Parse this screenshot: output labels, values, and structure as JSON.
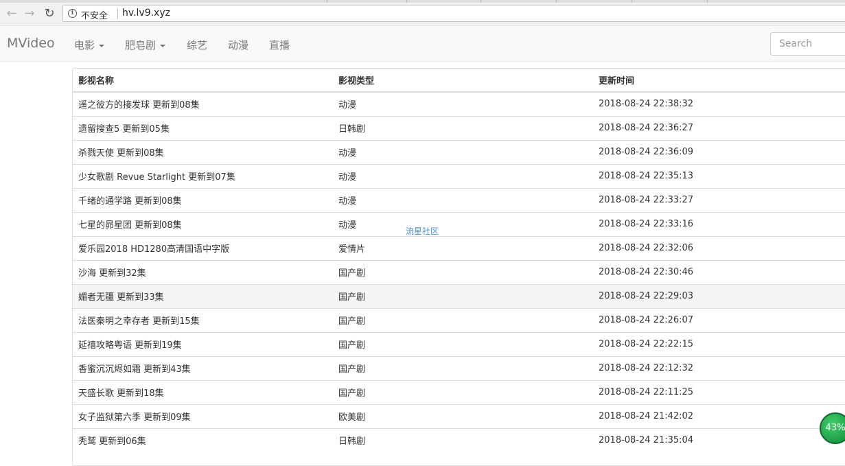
{
  "browser": {
    "security_label": "不安全",
    "url": "hv.lv9.xyz",
    "back_icon": "arrow-left-icon",
    "forward_icon": "arrow-right-icon",
    "reload_icon": "reload-icon",
    "info_icon": "info-icon"
  },
  "site": {
    "brand": "MVideo",
    "nav": [
      {
        "label": "电影",
        "dropdown": true
      },
      {
        "label": "肥皂剧",
        "dropdown": true
      },
      {
        "label": "综艺",
        "dropdown": false
      },
      {
        "label": "动漫",
        "dropdown": false
      },
      {
        "label": "直播",
        "dropdown": false
      }
    ],
    "search_placeholder": "Search"
  },
  "table": {
    "headers": [
      "影视名称",
      "影视类型",
      "更新时间"
    ],
    "rows": [
      [
        "遥之彼方的接发球 更新到08集",
        "动漫",
        "2018-08-24 22:38:32"
      ],
      [
        "遗留搜查5 更新到05集",
        "日韩剧",
        "2018-08-24 22:36:27"
      ],
      [
        "杀戮天使 更新到08集",
        "动漫",
        "2018-08-24 22:36:09"
      ],
      [
        "少女歌剧 Revue Starlight 更新到07集",
        "动漫",
        "2018-08-24 22:35:13"
      ],
      [
        "千绪的通学路 更新到08集",
        "动漫",
        "2018-08-24 22:33:27"
      ],
      [
        "七星的昴星团 更新到08集",
        "动漫",
        "2018-08-24 22:33:16"
      ],
      [
        "爱乐园2018 HD1280高清国语中字版",
        "爱情片",
        "2018-08-24 22:32:06"
      ],
      [
        "沙海 更新到32集",
        "国产剧",
        "2018-08-24 22:30:46"
      ],
      [
        "媚者无疆 更新到33集",
        "国产剧",
        "2018-08-24 22:29:03"
      ],
      [
        "法医秦明之幸存者 更新到15集",
        "国产剧",
        "2018-08-24 22:26:07"
      ],
      [
        "延禧攻略粤语 更新到19集",
        "国产剧",
        "2018-08-24 22:22:15"
      ],
      [
        "香蜜沉沉烬如霜 更新到43集",
        "国产剧",
        "2018-08-24 22:12:32"
      ],
      [
        "天盛长歌 更新到18集",
        "国产剧",
        "2018-08-24 22:11:25"
      ],
      [
        "女子监狱第六季 更新到09集",
        "欧美剧",
        "2018-08-24 21:42:02"
      ],
      [
        "秃鹫 更新到06集",
        "日韩剧",
        "2018-08-24 21:35:04"
      ]
    ],
    "hover_row_index": 8
  },
  "watermark": "流星社区",
  "badge": "43%"
}
